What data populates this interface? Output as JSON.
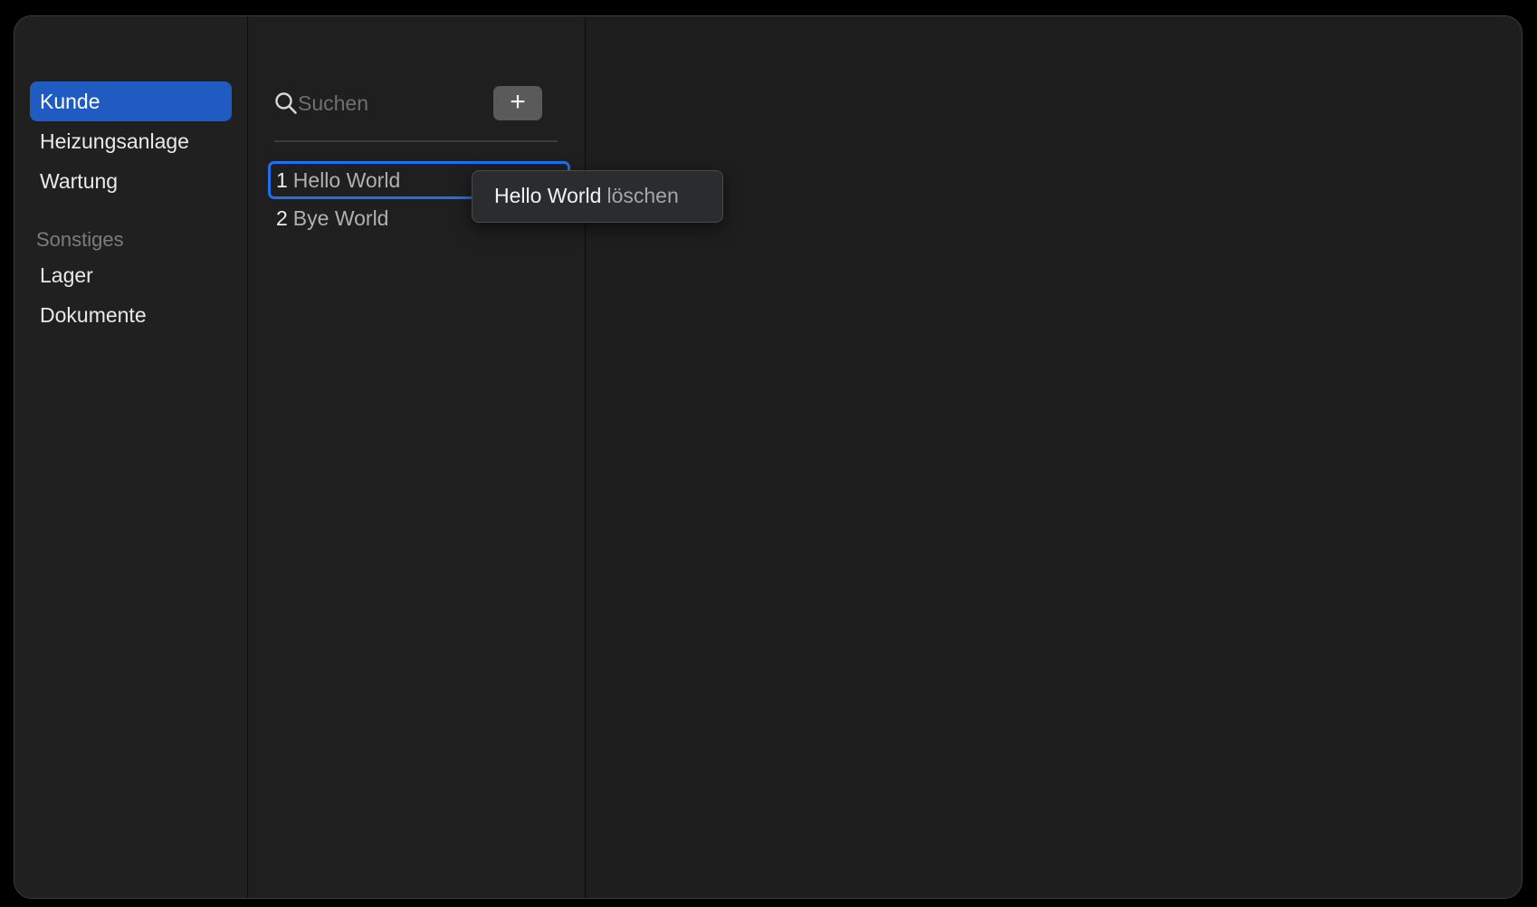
{
  "window": {
    "traffic_lights": {
      "close_color": "#ec5f59",
      "minimize_color": "#f4bf4f",
      "zoom_color": "#4b4b4b"
    }
  },
  "sidebar": {
    "items": [
      {
        "label": "Kunde",
        "selected": true
      },
      {
        "label": "Heizungsanlage",
        "selected": false
      },
      {
        "label": "Wartung",
        "selected": false
      }
    ],
    "section_title": "Sonstiges",
    "section_items": [
      {
        "label": "Lager"
      },
      {
        "label": "Dokumente"
      }
    ],
    "accent_color": "#1f5bc1"
  },
  "list": {
    "search": {
      "placeholder": "Suchen",
      "value": "",
      "icon": "magnifying-glass-icon"
    },
    "add_button": {
      "label": "+",
      "icon": "plus-icon"
    },
    "rows": [
      {
        "number": "1",
        "name": "Hello World",
        "focused": true
      },
      {
        "number": "2",
        "name": "Bye World",
        "focused": false
      }
    ],
    "focus_color": "#1f6ff0"
  },
  "context_menu": {
    "item_name": "Hello World",
    "item_action": "löschen"
  }
}
